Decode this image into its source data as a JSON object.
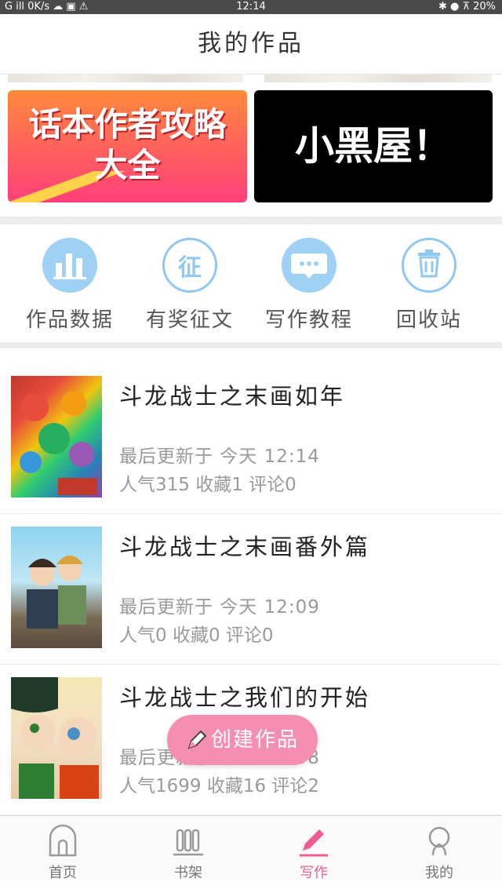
{
  "status_bar": {
    "left": "G ill 0K/s ☁ ▣ ⚠",
    "time": "12:14",
    "right": "✱ ● ⊼ 20%"
  },
  "header": {
    "title": "我的作品"
  },
  "banners": [
    {
      "line1": "话本作者攻略",
      "line2": "大全"
    },
    {
      "text": "小黑屋！"
    }
  ],
  "quick_actions": [
    {
      "label": "作品数据",
      "icon": "bar-chart-icon"
    },
    {
      "label": "有奖征文",
      "icon": "zheng-badge-icon",
      "glyph": "征"
    },
    {
      "label": "写作教程",
      "icon": "chat-bubble-icon",
      "glyph": "···"
    },
    {
      "label": "回收站",
      "icon": "trash-icon"
    }
  ],
  "works": [
    {
      "title": "斗龙战士之末画如年",
      "updated": "最后更新于 今天 12:14",
      "stats": "人气315 收藏1 评论0"
    },
    {
      "title": "斗龙战士之末画番外篇",
      "updated": "最后更新于 今天 12:09",
      "stats": "人气0 收藏0 评论0"
    },
    {
      "title": "斗龙战士之我们的开始",
      "updated": "最后更新于 今天 11:58",
      "stats": "人气1699 收藏16 评论2"
    }
  ],
  "fab": {
    "label": "创建作品",
    "icon": "pencil-icon"
  },
  "tabbar": [
    {
      "label": "首页",
      "icon": "home-icon"
    },
    {
      "label": "书架",
      "icon": "bookshelf-icon"
    },
    {
      "label": "写作",
      "icon": "pen-icon",
      "active": true
    },
    {
      "label": "我的",
      "icon": "profile-icon"
    }
  ],
  "colors": {
    "accent_pink": "#f48fb1",
    "active_tab": "#ef5f8d",
    "icon_blue": "#9fd1f5"
  }
}
